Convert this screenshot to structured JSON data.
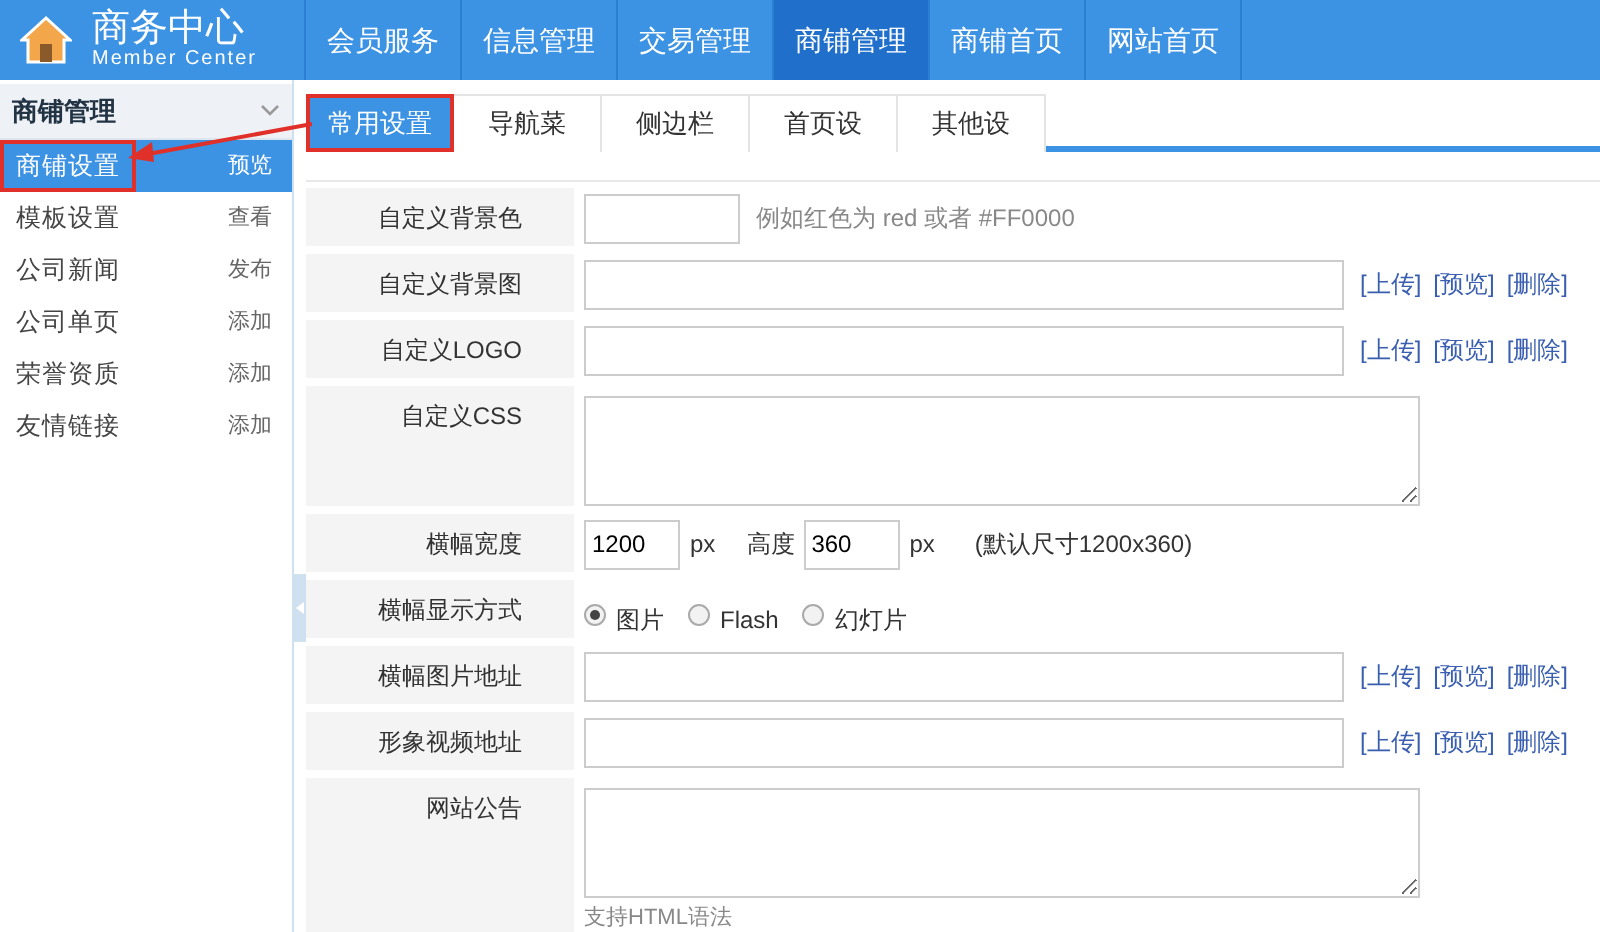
{
  "header": {
    "title": "商务中心",
    "subtitle": "Member Center",
    "nav": [
      {
        "label": "会员服务",
        "selected": false
      },
      {
        "label": "信息管理",
        "selected": false
      },
      {
        "label": "交易管理",
        "selected": false
      },
      {
        "label": "商铺管理",
        "selected": true
      },
      {
        "label": "商铺首页",
        "selected": false
      },
      {
        "label": "网站首页",
        "selected": false
      }
    ]
  },
  "sidebar": {
    "title": "商铺管理",
    "expanded": true,
    "items": [
      {
        "label": "商铺设置",
        "action": "预览",
        "selected": true,
        "highlighted": true
      },
      {
        "label": "模板设置",
        "action": "查看",
        "selected": false,
        "highlighted": false
      },
      {
        "label": "公司新闻",
        "action": "发布",
        "selected": false,
        "highlighted": false
      },
      {
        "label": "公司单页",
        "action": "添加",
        "selected": false,
        "highlighted": false
      },
      {
        "label": "荣誉资质",
        "action": "添加",
        "selected": false,
        "highlighted": false
      },
      {
        "label": "友情链接",
        "action": "添加",
        "selected": false,
        "highlighted": false
      }
    ]
  },
  "tabs": [
    {
      "label": "常用设置",
      "selected": true,
      "highlighted": true
    },
    {
      "label": "导航菜",
      "selected": false,
      "highlighted": false
    },
    {
      "label": "侧边栏",
      "selected": false,
      "highlighted": false
    },
    {
      "label": "首页设",
      "selected": false,
      "highlighted": false
    },
    {
      "label": "其他设",
      "selected": false,
      "highlighted": false
    }
  ],
  "form": {
    "rows": [
      {
        "label": "自定义背景色",
        "kind": "short",
        "hint": "例如红色为 red 或者 #FF0000"
      },
      {
        "label": "自定义背景图",
        "kind": "upload",
        "links": [
          "[上传]",
          "[预览]",
          "[删除]"
        ]
      },
      {
        "label": "自定义LOGO",
        "kind": "upload",
        "links": [
          "[上传]",
          "[预览]",
          "[删除]"
        ]
      },
      {
        "label": "自定义CSS",
        "kind": "textarea"
      },
      {
        "label": "横幅宽度",
        "kind": "size",
        "width_value": "1200",
        "width_unit": "px",
        "height_label": "高度",
        "height_value": "360",
        "height_unit": "px",
        "note": "(默认尺寸1200x360)"
      },
      {
        "label": "横幅显示方式",
        "kind": "radio",
        "options": [
          {
            "label": "图片",
            "selected": true
          },
          {
            "label": "Flash",
            "selected": false
          },
          {
            "label": "幻灯片",
            "selected": false
          }
        ]
      },
      {
        "label": "横幅图片地址",
        "kind": "upload",
        "links": [
          "[上传]",
          "[预览]",
          "[删除]"
        ]
      },
      {
        "label": "形象视频地址",
        "kind": "upload",
        "links": [
          "[上传]",
          "[预览]",
          "[删除]"
        ]
      },
      {
        "label": "网站公告",
        "kind": "textarea",
        "hint": "支持HTML语法"
      }
    ]
  }
}
